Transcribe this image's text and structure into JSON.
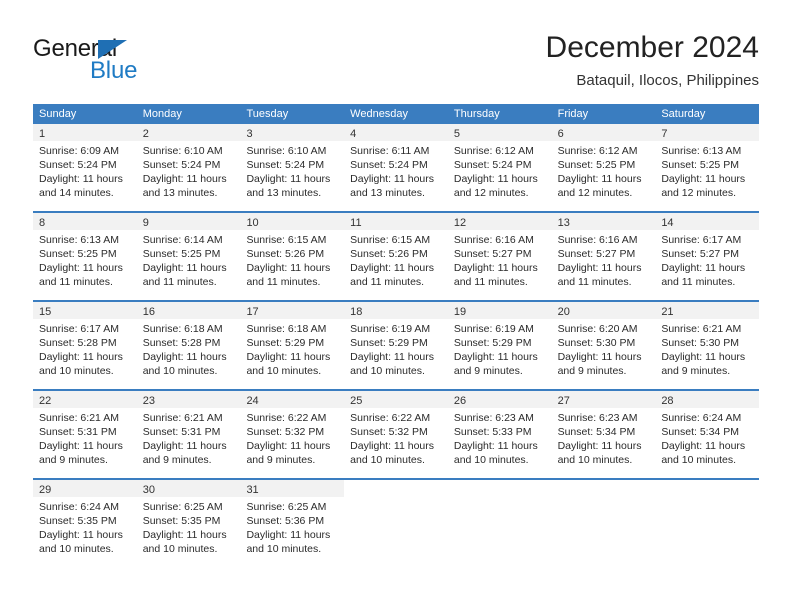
{
  "brand": {
    "name_part1": "General",
    "name_part2": "Blue",
    "triangle_icon": "blue-triangle-icon",
    "accent_color": "#1f7bc4"
  },
  "header": {
    "title": "December 2024",
    "subtitle": "Bataquil, Ilocos, Philippines"
  },
  "calendar": {
    "header_bg": "#3a7dc0",
    "day_band_bg": "#f2f2f2",
    "weekdays": [
      "Sunday",
      "Monday",
      "Tuesday",
      "Wednesday",
      "Thursday",
      "Friday",
      "Saturday"
    ],
    "weeks": [
      [
        {
          "day": "1",
          "sunrise": "Sunrise: 6:09 AM",
          "sunset": "Sunset: 5:24 PM",
          "daylight_line1": "Daylight: 11 hours",
          "daylight_line2": "and 14 minutes."
        },
        {
          "day": "2",
          "sunrise": "Sunrise: 6:10 AM",
          "sunset": "Sunset: 5:24 PM",
          "daylight_line1": "Daylight: 11 hours",
          "daylight_line2": "and 13 minutes."
        },
        {
          "day": "3",
          "sunrise": "Sunrise: 6:10 AM",
          "sunset": "Sunset: 5:24 PM",
          "daylight_line1": "Daylight: 11 hours",
          "daylight_line2": "and 13 minutes."
        },
        {
          "day": "4",
          "sunrise": "Sunrise: 6:11 AM",
          "sunset": "Sunset: 5:24 PM",
          "daylight_line1": "Daylight: 11 hours",
          "daylight_line2": "and 13 minutes."
        },
        {
          "day": "5",
          "sunrise": "Sunrise: 6:12 AM",
          "sunset": "Sunset: 5:24 PM",
          "daylight_line1": "Daylight: 11 hours",
          "daylight_line2": "and 12 minutes."
        },
        {
          "day": "6",
          "sunrise": "Sunrise: 6:12 AM",
          "sunset": "Sunset: 5:25 PM",
          "daylight_line1": "Daylight: 11 hours",
          "daylight_line2": "and 12 minutes."
        },
        {
          "day": "7",
          "sunrise": "Sunrise: 6:13 AM",
          "sunset": "Sunset: 5:25 PM",
          "daylight_line1": "Daylight: 11 hours",
          "daylight_line2": "and 12 minutes."
        }
      ],
      [
        {
          "day": "8",
          "sunrise": "Sunrise: 6:13 AM",
          "sunset": "Sunset: 5:25 PM",
          "daylight_line1": "Daylight: 11 hours",
          "daylight_line2": "and 11 minutes."
        },
        {
          "day": "9",
          "sunrise": "Sunrise: 6:14 AM",
          "sunset": "Sunset: 5:25 PM",
          "daylight_line1": "Daylight: 11 hours",
          "daylight_line2": "and 11 minutes."
        },
        {
          "day": "10",
          "sunrise": "Sunrise: 6:15 AM",
          "sunset": "Sunset: 5:26 PM",
          "daylight_line1": "Daylight: 11 hours",
          "daylight_line2": "and 11 minutes."
        },
        {
          "day": "11",
          "sunrise": "Sunrise: 6:15 AM",
          "sunset": "Sunset: 5:26 PM",
          "daylight_line1": "Daylight: 11 hours",
          "daylight_line2": "and 11 minutes."
        },
        {
          "day": "12",
          "sunrise": "Sunrise: 6:16 AM",
          "sunset": "Sunset: 5:27 PM",
          "daylight_line1": "Daylight: 11 hours",
          "daylight_line2": "and 11 minutes."
        },
        {
          "day": "13",
          "sunrise": "Sunrise: 6:16 AM",
          "sunset": "Sunset: 5:27 PM",
          "daylight_line1": "Daylight: 11 hours",
          "daylight_line2": "and 11 minutes."
        },
        {
          "day": "14",
          "sunrise": "Sunrise: 6:17 AM",
          "sunset": "Sunset: 5:27 PM",
          "daylight_line1": "Daylight: 11 hours",
          "daylight_line2": "and 11 minutes."
        }
      ],
      [
        {
          "day": "15",
          "sunrise": "Sunrise: 6:17 AM",
          "sunset": "Sunset: 5:28 PM",
          "daylight_line1": "Daylight: 11 hours",
          "daylight_line2": "and 10 minutes."
        },
        {
          "day": "16",
          "sunrise": "Sunrise: 6:18 AM",
          "sunset": "Sunset: 5:28 PM",
          "daylight_line1": "Daylight: 11 hours",
          "daylight_line2": "and 10 minutes."
        },
        {
          "day": "17",
          "sunrise": "Sunrise: 6:18 AM",
          "sunset": "Sunset: 5:29 PM",
          "daylight_line1": "Daylight: 11 hours",
          "daylight_line2": "and 10 minutes."
        },
        {
          "day": "18",
          "sunrise": "Sunrise: 6:19 AM",
          "sunset": "Sunset: 5:29 PM",
          "daylight_line1": "Daylight: 11 hours",
          "daylight_line2": "and 10 minutes."
        },
        {
          "day": "19",
          "sunrise": "Sunrise: 6:19 AM",
          "sunset": "Sunset: 5:29 PM",
          "daylight_line1": "Daylight: 11 hours",
          "daylight_line2": "and 9 minutes."
        },
        {
          "day": "20",
          "sunrise": "Sunrise: 6:20 AM",
          "sunset": "Sunset: 5:30 PM",
          "daylight_line1": "Daylight: 11 hours",
          "daylight_line2": "and 9 minutes."
        },
        {
          "day": "21",
          "sunrise": "Sunrise: 6:21 AM",
          "sunset": "Sunset: 5:30 PM",
          "daylight_line1": "Daylight: 11 hours",
          "daylight_line2": "and 9 minutes."
        }
      ],
      [
        {
          "day": "22",
          "sunrise": "Sunrise: 6:21 AM",
          "sunset": "Sunset: 5:31 PM",
          "daylight_line1": "Daylight: 11 hours",
          "daylight_line2": "and 9 minutes."
        },
        {
          "day": "23",
          "sunrise": "Sunrise: 6:21 AM",
          "sunset": "Sunset: 5:31 PM",
          "daylight_line1": "Daylight: 11 hours",
          "daylight_line2": "and 9 minutes."
        },
        {
          "day": "24",
          "sunrise": "Sunrise: 6:22 AM",
          "sunset": "Sunset: 5:32 PM",
          "daylight_line1": "Daylight: 11 hours",
          "daylight_line2": "and 9 minutes."
        },
        {
          "day": "25",
          "sunrise": "Sunrise: 6:22 AM",
          "sunset": "Sunset: 5:32 PM",
          "daylight_line1": "Daylight: 11 hours",
          "daylight_line2": "and 10 minutes."
        },
        {
          "day": "26",
          "sunrise": "Sunrise: 6:23 AM",
          "sunset": "Sunset: 5:33 PM",
          "daylight_line1": "Daylight: 11 hours",
          "daylight_line2": "and 10 minutes."
        },
        {
          "day": "27",
          "sunrise": "Sunrise: 6:23 AM",
          "sunset": "Sunset: 5:34 PM",
          "daylight_line1": "Daylight: 11 hours",
          "daylight_line2": "and 10 minutes."
        },
        {
          "day": "28",
          "sunrise": "Sunrise: 6:24 AM",
          "sunset": "Sunset: 5:34 PM",
          "daylight_line1": "Daylight: 11 hours",
          "daylight_line2": "and 10 minutes."
        }
      ],
      [
        {
          "day": "29",
          "sunrise": "Sunrise: 6:24 AM",
          "sunset": "Sunset: 5:35 PM",
          "daylight_line1": "Daylight: 11 hours",
          "daylight_line2": "and 10 minutes."
        },
        {
          "day": "30",
          "sunrise": "Sunrise: 6:25 AM",
          "sunset": "Sunset: 5:35 PM",
          "daylight_line1": "Daylight: 11 hours",
          "daylight_line2": "and 10 minutes."
        },
        {
          "day": "31",
          "sunrise": "Sunrise: 6:25 AM",
          "sunset": "Sunset: 5:36 PM",
          "daylight_line1": "Daylight: 11 hours",
          "daylight_line2": "and 10 minutes."
        },
        {
          "day": "",
          "sunrise": "",
          "sunset": "",
          "daylight_line1": "",
          "daylight_line2": ""
        },
        {
          "day": "",
          "sunrise": "",
          "sunset": "",
          "daylight_line1": "",
          "daylight_line2": ""
        },
        {
          "day": "",
          "sunrise": "",
          "sunset": "",
          "daylight_line1": "",
          "daylight_line2": ""
        },
        {
          "day": "",
          "sunrise": "",
          "sunset": "",
          "daylight_line1": "",
          "daylight_line2": ""
        }
      ]
    ]
  }
}
